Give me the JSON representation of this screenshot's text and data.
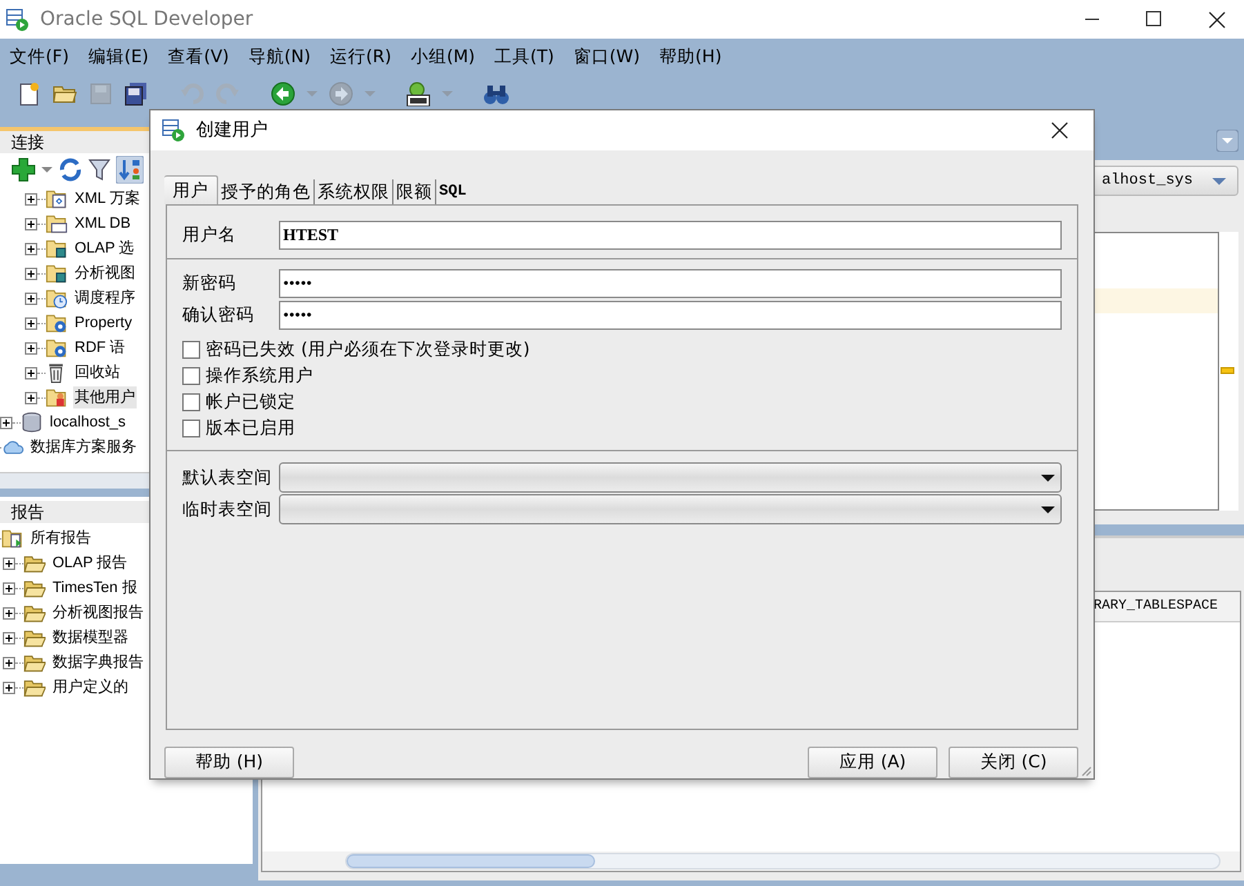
{
  "window": {
    "title": "Oracle SQL Developer"
  },
  "menu": [
    "文件(F)",
    "编辑(E)",
    "查看(V)",
    "导航(N)",
    "运行(R)",
    "小组(M)",
    "工具(T)",
    "窗口(W)",
    "帮助(H)"
  ],
  "toolbar": [
    {
      "kind": "new",
      "disabled": false
    },
    {
      "kind": "open",
      "disabled": false
    },
    {
      "kind": "save",
      "disabled": true
    },
    {
      "kind": "save-all",
      "disabled": false
    },
    {
      "kind": "gap"
    },
    {
      "kind": "undo",
      "disabled": true
    },
    {
      "kind": "redo",
      "disabled": true
    },
    {
      "kind": "gap"
    },
    {
      "kind": "back",
      "disabled": false
    },
    {
      "kind": "caret",
      "disabled": true
    },
    {
      "kind": "forward",
      "disabled": true
    },
    {
      "kind": "caret",
      "disabled": true
    },
    {
      "kind": "gap"
    },
    {
      "kind": "sql",
      "disabled": false
    },
    {
      "kind": "caret",
      "disabled": true
    },
    {
      "kind": "gap"
    },
    {
      "kind": "find",
      "disabled": false
    }
  ],
  "connections": {
    "title": "连接",
    "tree": [
      {
        "children": [
          {
            "label": "XML 万案",
            "kind": "xml-schema",
            "expanded": false
          },
          {
            "label": "XML DB",
            "kind": "xml-db",
            "expanded": false
          },
          {
            "label": "OLAP 选",
            "kind": "folder-db",
            "expanded": false
          },
          {
            "label": "分析视图",
            "kind": "folder-db",
            "expanded": false
          },
          {
            "label": "调度程序",
            "kind": "folder-clock",
            "expanded": false
          },
          {
            "label": "Property",
            "kind": "folder-gear",
            "expanded": false
          },
          {
            "label": "RDF 语",
            "kind": "folder-gear",
            "expanded": false
          },
          {
            "label": "回收站",
            "kind": "trash",
            "expanded": false
          },
          {
            "label": "其他用户",
            "kind": "folder-person",
            "expanded": false,
            "selected": true
          }
        ]
      },
      {
        "label": "localhost_s",
        "kind": "database",
        "expanded": false
      },
      {
        "label": "数据库方案服务",
        "kind": "cloud"
      }
    ]
  },
  "reports": {
    "title": "报告",
    "tree": [
      {
        "label": "所有报告",
        "kind": "report-root",
        "children": [
          {
            "label": "OLAP 报告",
            "kind": "report-folder",
            "expanded": false
          },
          {
            "label": "TimesTen 报",
            "kind": "report-folder",
            "expanded": false
          },
          {
            "label": "分析视图报告",
            "kind": "report-folder",
            "expanded": false
          },
          {
            "label": "数据模型器",
            "kind": "report-folder",
            "expanded": false
          },
          {
            "label": "数据字典报告",
            "kind": "report-folder",
            "expanded": false
          },
          {
            "label": "用户定义的",
            "kind": "report-folder",
            "expanded": false
          }
        ]
      }
    ]
  },
  "editor": {
    "connection": "alhost_sys",
    "table_header": "RARY_TABLESPACE"
  },
  "dialog": {
    "title": "创建用户",
    "tabs": [
      {
        "label": "用户",
        "selected": true
      },
      {
        "label": "授予的角色",
        "selected": false
      },
      {
        "label": "系统权限",
        "selected": false
      },
      {
        "label": "限额",
        "selected": false
      },
      {
        "label": "SQL",
        "selected": false
      }
    ],
    "username": {
      "label": "用户名",
      "value": "HTEST"
    },
    "passwords": [
      {
        "label": "新密码",
        "value": "•••••"
      },
      {
        "label": "确认密码",
        "value": "•••••"
      }
    ],
    "checkboxes": [
      {
        "label": "密码已失效 (用户必须在下次登录时更改)",
        "checked": false
      },
      {
        "label": "操作系统用户",
        "checked": false
      },
      {
        "label": "帐户已锁定",
        "checked": false
      },
      {
        "label": "版本已启用",
        "checked": false
      }
    ],
    "tablespaces": [
      {
        "label": "默认表空间"
      },
      {
        "label": "临时表空间"
      }
    ],
    "buttons": [
      {
        "label": "帮助 (H)",
        "kind": "left"
      },
      {
        "label": "应用 (A)",
        "kind": "right"
      },
      {
        "label": "关闭 (C)",
        "kind": "right"
      }
    ]
  }
}
